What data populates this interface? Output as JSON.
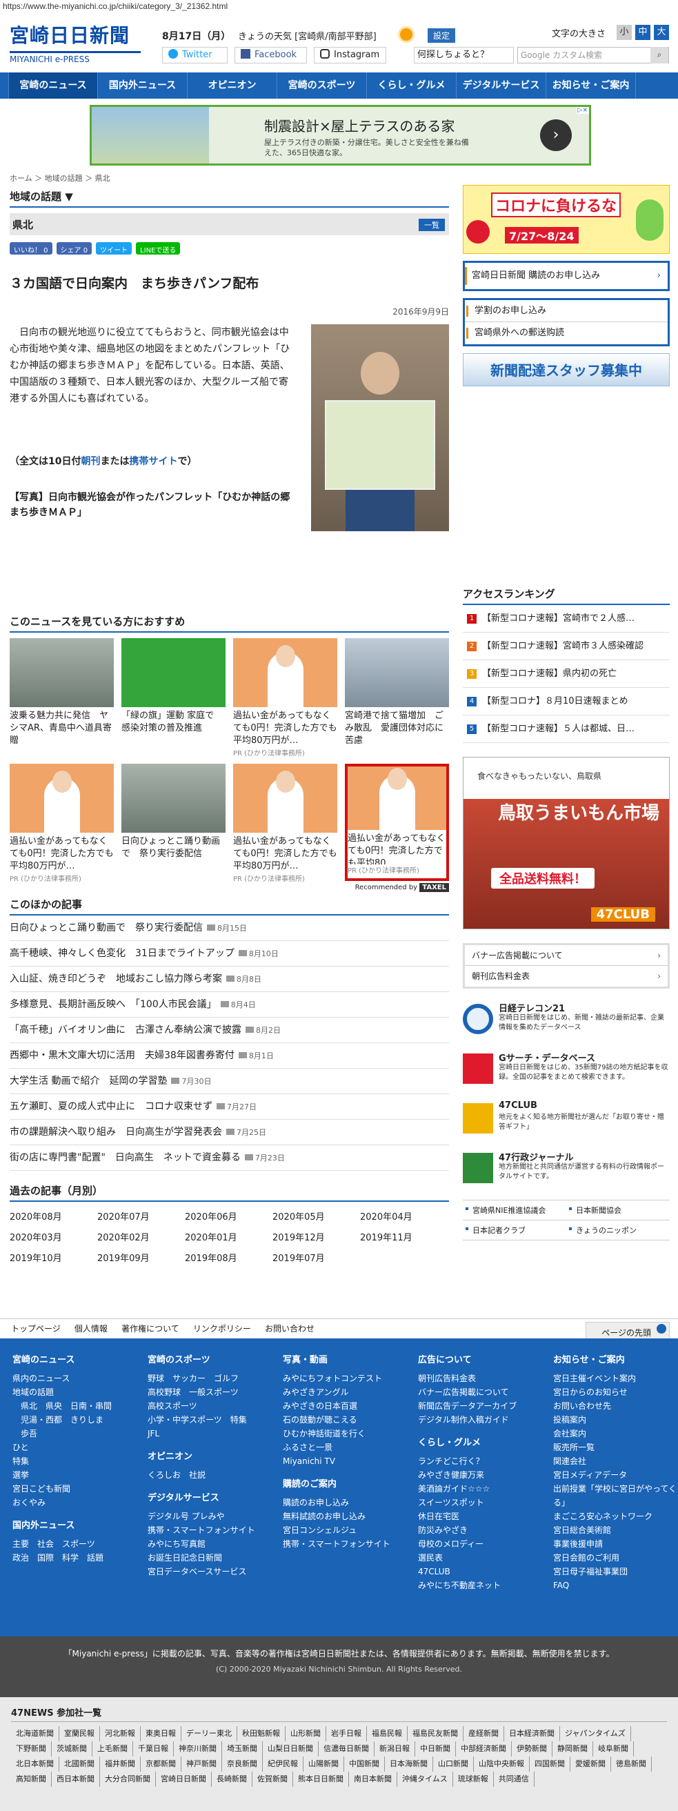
{
  "url": "https://www.the-miyanichi.co.jp/chiiki/category_3/_21362.html",
  "header": {
    "logo_main": "宮崎日日新聞",
    "logo_sub": "MIYANICHI e-PRESS",
    "date": "8月17日（月）",
    "weather": "きょうの天気 [宮崎県/南部平野部]",
    "settings": "設定",
    "fontsize_label": "文字の大きさ",
    "fs_small": "小",
    "fs_mid": "中",
    "fs_large": "大",
    "twitter": "Twitter",
    "facebook": "Facebook",
    "instagram": "Instagram",
    "question": "何探しちょると？",
    "search_placeholder": "Google カスタム検索"
  },
  "nav": [
    "宮崎のニュース",
    "国内外ニュース",
    "オピニオン",
    "宮崎のスポーツ",
    "くらし・グルメ",
    "デジタルサービス",
    "お知らせ・ご案内"
  ],
  "ad_top": {
    "headline": "制震設計×屋上テラスのある家",
    "desc": "屋上テラス付きの新築・分譲住宅。美しさと安全性を兼ね備えた、365日快適な家。"
  },
  "breadcrumb": "ホーム ＞ 地域の話題 ＞ 県北",
  "article": {
    "section": "地域の話題 ▼",
    "subsection": "県北",
    "list_btn": "一覧",
    "share_fb": "いいね！ 0",
    "share_fb2": "シェア 0",
    "share_tw": "ツイート",
    "share_line": "LINEで送る",
    "title": "３カ国語で日向案内　まち歩きパンフ配布",
    "date": "2016年9月9日",
    "body": "　日向市の観光地巡りに役立ててもらおうと、同市観光協会は中心市街地や美々津、細島地区の地図をまとめたパンフレット「ひむか神話の郷まち歩きＭＡＰ」を配布している。日本語、英語、中国語版の３種類で、日本人観光客のほか、大型クルーズ船で寄港する外国人にも喜ばれている。",
    "full_pre": "（全文は10日付",
    "full_l1": "朝刊",
    "full_mid": "または",
    "full_l2": "携帯サイト",
    "full_post": "で）",
    "caption": "【写真】日向市観光協会が作ったパンフレット「ひむか神話の郷まち歩きＭＡＰ」"
  },
  "reco": {
    "title": "このニュースを見ている方におすすめ",
    "items": [
      {
        "text": "波乗る魅力共に発信　ヤシマAR、青島中へ道具寄贈",
        "pr": ""
      },
      {
        "text": "「緑の旗」運動 家庭で　感染対策の普及推進",
        "pr": ""
      },
      {
        "text": "過払い金があってもなくても0円！完済した方でも平均80万円が…",
        "pr": "PR (ひかり法律事務所)"
      },
      {
        "text": "宮崎港で捨て猫増加　ごみ散乱　愛護団体対応に苦慮",
        "pr": ""
      },
      {
        "text": "過払い金があってもなくても0円！完済した方でも平均80万円が…",
        "pr": "PR (ひかり法律事務所)"
      },
      {
        "text": "日向ひょっとこ踊り動画で　祭り実行委配信",
        "pr": ""
      },
      {
        "text": "過払い金があってもなくても0円！完済した方でも平均80万円が…",
        "pr": "PR (ひかり法律事務所)"
      },
      {
        "text": "過払い金があってもなくても0円！完済した方でも平均80…",
        "pr": "PR (ひかり法律事務所)"
      }
    ],
    "recommended": "Recommended by",
    "brand": "TAXEL"
  },
  "others": {
    "title": "このほかの記事",
    "rows": [
      {
        "t": "日向ひょっとこ踊り動画で　祭り実行委配信",
        "d": "8月15日"
      },
      {
        "t": "高千穂峡、神々しく色変化　31日までライトアップ",
        "d": "8月10日"
      },
      {
        "t": "入山証、焼き印どうぞ　地域おこし協力隊ら考案",
        "d": "8月8日"
      },
      {
        "t": "多様意見、長期計画反映へ　「100人市民会議」",
        "d": "8月4日"
      },
      {
        "t": "「高千穂」バイオリン曲に　古澤さん奉納公演で披露",
        "d": "8月2日"
      },
      {
        "t": "西郷中・黒木文庫大切に活用　夫婦38年図書券寄付",
        "d": "8月1日"
      },
      {
        "t": "大学生活 動画で紹介　延岡の学習塾",
        "d": "7月30日"
      },
      {
        "t": "五ケ瀬町、夏の成人式中止に　コロナ収束せず",
        "d": "7月27日"
      },
      {
        "t": "市の課題解決へ取り組み　日向高生が学習発表会",
        "d": "7月25日"
      },
      {
        "t": "街の店に専門書\"配置\"　日向高生　ネットで資金募る",
        "d": "7月23日"
      }
    ]
  },
  "past": {
    "title": "過去の記事（月別）",
    "months": [
      "2020年08月",
      "2020年07月",
      "2020年06月",
      "2020年05月",
      "2020年04月",
      "2020年03月",
      "2020年02月",
      "2020年01月",
      "2019年12月",
      "2019年11月",
      "2019年10月",
      "2019年09月",
      "2019年08月",
      "2019年07月"
    ]
  },
  "side": {
    "covid_t1": "コロナに負けるな",
    "covid_t2": "キャンペーン",
    "covid_period": "7/27～8/24",
    "subscribe": "宮崎日日新聞 購読のお申し込み",
    "study": "学割のお申し込み",
    "mail": "宮崎県外への郵送购読",
    "recruit": "新聞配達スタッフ募集中",
    "rank_title": "アクセスランキング",
    "ranks": [
      "【新型コロナ速報】宮崎市で２人感…",
      "【新型コロナ速報】宮崎市３人感染確認",
      "【新型コロナ速報】県内初の死亡",
      "【新型コロナ】８月10日速報まとめ",
      "【新型コロナ速報】５人は都城、日…"
    ],
    "ad2_tag": "食べなきゃもったいない、鳥取県",
    "ad2_t1": "鳥取うまいもん市場",
    "ad2_t2": "全品送料無料！",
    "ad2_t3": "47CLUB",
    "links": [
      "バナー広告掲載について",
      "朝刊広告料金表"
    ],
    "db": [
      {
        "n": "日経テレコン21",
        "d": "宮崎日日新聞をはじめ、新聞・雑誌の最新記事、企業情報を集めたデータベース"
      },
      {
        "n": "Gサーチ・データベース",
        "d": "宮崎日日新聞をはじめ、35新聞79誌の地方紙記事を収録。全国の記事をまとめて検索できます。"
      },
      {
        "n": "47CLUB",
        "d": "地元をよく知る地方新聞社が選んだ「お取り寄せ・贈答ギフト」"
      },
      {
        "n": "47行政ジャーナル",
        "d": "地方新聞社と共同通信が運営する有料の行政情報ポータルサイトです。"
      }
    ],
    "small": [
      "宮崎県NIE推進協議会",
      "日本新聞協会",
      "日本記者クラブ",
      "きょうのニッポン"
    ]
  },
  "footlinks": [
    "トップページ",
    "個人情報",
    "著作権について",
    "リンクポリシー",
    "お問い合わせ"
  ],
  "topbtn": "ページの先頭",
  "footer": {
    "c1": {
      "h": "宮崎のニュース",
      "items": [
        "県内のニュース",
        "地域の話題",
        "　県北　県央　日南・串間",
        "　児湯・西都　きりしま",
        "　歩吾",
        "ひと",
        "特集",
        "選挙",
        "宮日こども新聞",
        "おくやみ"
      ],
      "h2": "国内外ニュース",
      "items2": [
        "主要　社会　スポーツ",
        "政治　国際　科学　話題"
      ]
    },
    "c2": {
      "h": "宮崎のスポーツ",
      "items": [
        "野球　サッカー　ゴルフ",
        "高校野球　一般スポーツ",
        "高校スポーツ",
        "小学・中学スポーツ　特集",
        "JFL"
      ],
      "h2": "オピニオン",
      "items2": [
        "くろしお　社説"
      ],
      "h3": "デジタルサービス",
      "items3": [
        "デジタル号 プレみや",
        "携帯・スマートフォンサイト",
        "みやにち写真館",
        "お誕生日記念日新聞",
        "宮日データベースサービス"
      ]
    },
    "c3": {
      "h": "写真・動画",
      "items": [
        "みやにちフォトコンテスト",
        "みやざきアングル",
        "みやざきの日本百選",
        "石の鼓動が聴こえる",
        "ひむか神話街道を行く",
        "ふるさと一景",
        "Miyanichi TV"
      ],
      "h2": "購読のご案内",
      "items2": [
        "購読のお申し込み",
        "無料試読のお申し込み",
        "宮日コンシェルジュ",
        "携帯・スマートフォンサイト"
      ]
    },
    "c4": {
      "h": "広告について",
      "items": [
        "朝刊広告料金表",
        "バナー広告掲載について",
        "新聞広告データアーカイブ",
        "デジタル制作入稿ガイド"
      ],
      "h2": "くらし・グルメ",
      "items2": [
        "ランチどこ行く？",
        "みやざき健康万来",
        "美酒論ガイド☆☆☆",
        "スイーツスポット",
        "休日在宅医",
        "防災みやざき",
        "母校のメロディー",
        "選民表",
        "47CLUB",
        "みやにち不動産ネット"
      ]
    },
    "c5": {
      "h": "お知らせ・ご案内",
      "items": [
        "宮日主催イベント案内",
        "宮日からのお知らせ",
        "お問い合わせ先",
        "投稿案内",
        "会社案内",
        "販売所一覧",
        "関連会社",
        "宮日メディアデータ",
        "出前授業「学校に宮日がやってくる」",
        "まごころ安心ネットワーク",
        "宮日総合美術館",
        "事業後援申請",
        "宮日会館のご利用",
        "宮日母子福祉事業団",
        "FAQ"
      ]
    }
  },
  "copy": {
    "l1": "「Miyanichi e-press」に掲載の記事、写真、音楽等の著作権は宮崎日日新聞社または、各情報提供者にあります。無断掲載、無断使用を禁じます。",
    "l2": "(C) 2000-2020 Miyazaki Nichinichi Shimbun. All Rights Reserved."
  },
  "n47": {
    "title": "47NEWS 参加社一覧",
    "items": [
      "北海道新聞",
      "室蘭民報",
      "河北新報",
      "東奥日報",
      "デーリー東北",
      "秋田魁新報",
      "山形新聞",
      "岩手日報",
      "福島民報",
      "福島民友新聞",
      "産経新聞",
      "日本経済新聞",
      "ジャパンタイムズ",
      "下野新聞",
      "茨城新聞",
      "上毛新聞",
      "千葉日報",
      "神奈川新聞",
      "埼玉新聞",
      "山梨日日新聞",
      "信濃毎日新聞",
      "新潟日報",
      "中日新聞",
      "中部経済新聞",
      "伊勢新聞",
      "静岡新聞",
      "岐阜新聞",
      "北日本新聞",
      "北國新聞",
      "福井新聞",
      "京都新聞",
      "神戸新聞",
      "奈良新聞",
      "紀伊民報",
      "山陽新聞",
      "中国新聞",
      "日本海新聞",
      "山口新聞",
      "山陰中央新報",
      "四国新聞",
      "愛媛新聞",
      "徳島新聞",
      "高知新聞",
      "西日本新聞",
      "大分合同新聞",
      "宮崎日日新聞",
      "長崎新聞",
      "佐賀新聞",
      "熊本日日新聞",
      "南日本新聞",
      "沖縄タイムス",
      "琉球新報",
      "共同通信"
    ]
  }
}
